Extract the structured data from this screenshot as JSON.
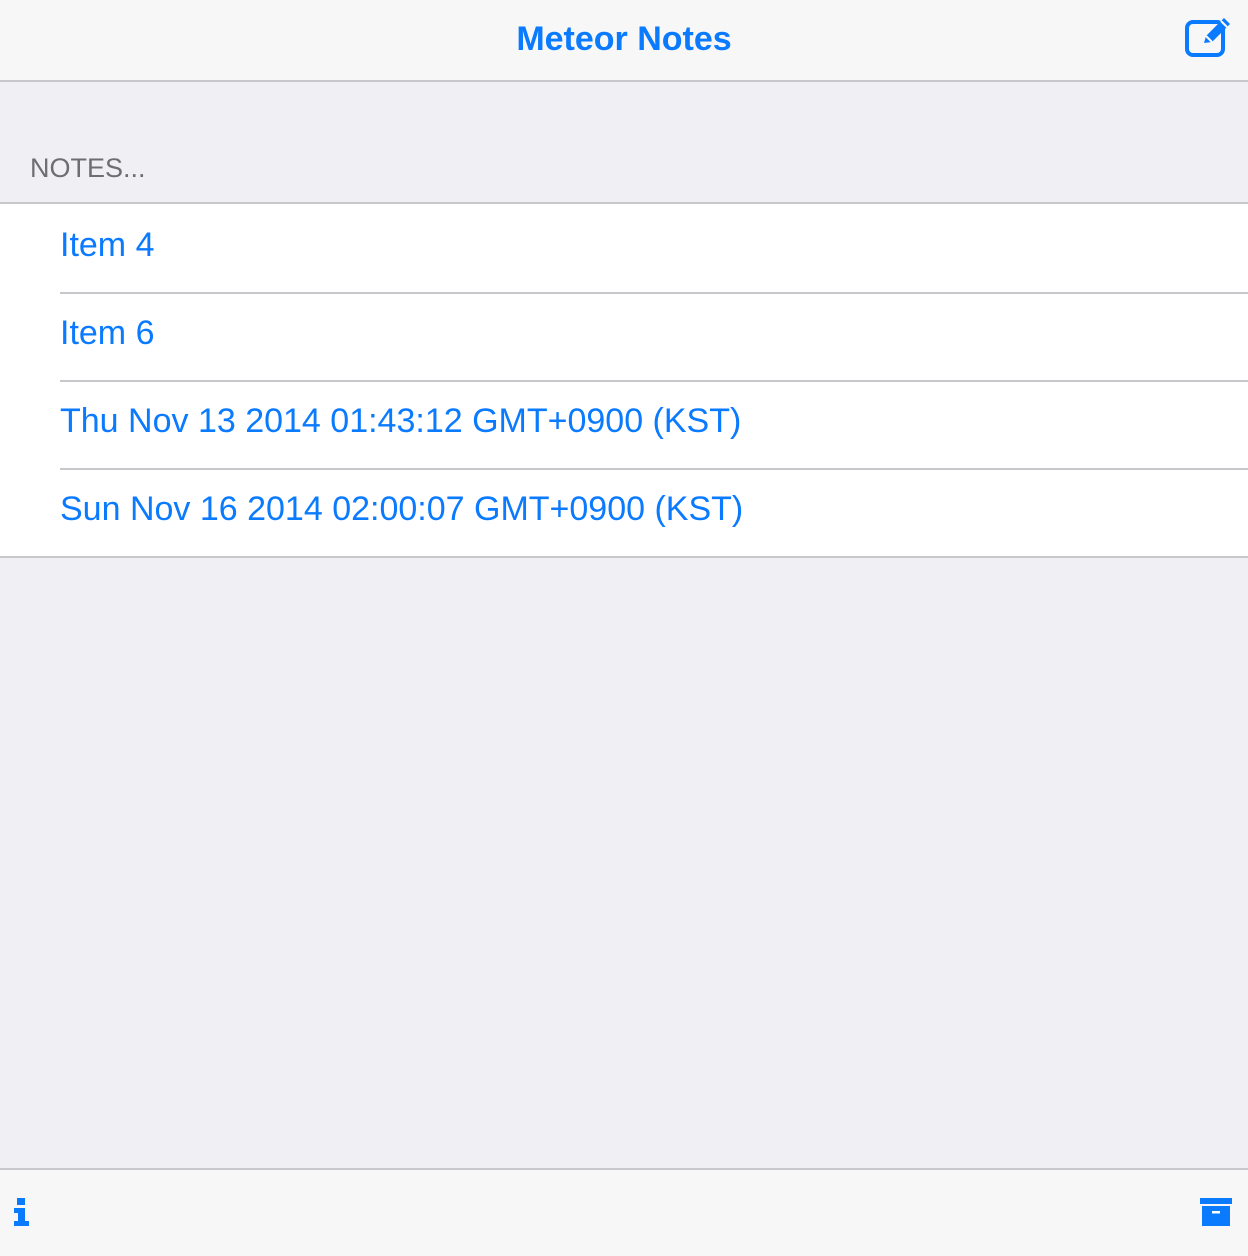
{
  "navbar": {
    "title": "Meteor Notes",
    "compose_icon": "compose-icon"
  },
  "section": {
    "header": "NOTES..."
  },
  "notes": [
    {
      "label": "Item 4"
    },
    {
      "label": "Item 6"
    },
    {
      "label": "Thu Nov 13 2014 01:43:12 GMT+0900 (KST)"
    },
    {
      "label": "Sun Nov 16 2014 02:00:07 GMT+0900 (KST)"
    }
  ],
  "toolbar": {
    "info_icon": "info-icon",
    "archive_icon": "archive-icon"
  },
  "colors": {
    "accent": "#0a7aff",
    "background": "#efeff4",
    "bar": "#f7f7f7",
    "separator": "#c8c7cc",
    "section_text": "#6d6d72"
  }
}
